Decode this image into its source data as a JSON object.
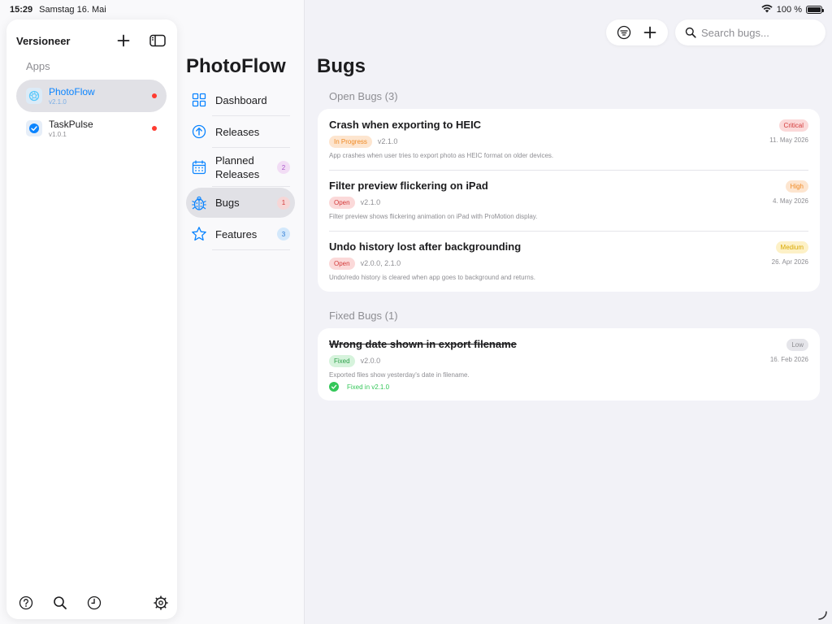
{
  "status_bar": {
    "time": "15:29",
    "date": "Samstag 16. Mai",
    "battery": "100 %"
  },
  "sidebar": {
    "title": "Versioneer",
    "section_label": "Apps",
    "apps": [
      {
        "name": "PhotoFlow",
        "version": "v2.1.0",
        "selected": true,
        "icon": "camera-aperture-icon",
        "color": "#5ac8fa"
      },
      {
        "name": "TaskPulse",
        "version": "v1.0.1",
        "selected": false,
        "icon": "checkmark-circle-icon",
        "color": "#0a84ff"
      }
    ]
  },
  "nav": {
    "project_title": "PhotoFlow",
    "items": [
      {
        "label": "Dashboard",
        "icon": "grid-icon",
        "badge": ""
      },
      {
        "label": "Releases",
        "icon": "arrow-up-circle-icon",
        "badge": ""
      },
      {
        "label": "Planned\nReleases",
        "icon": "calendar-icon",
        "badge": "2",
        "badge_color": "#f2ddf5",
        "badge_text_color": "#a855c8"
      },
      {
        "label": "Bugs",
        "icon": "ladybug-icon",
        "badge": "1",
        "badge_color": "#f6d6d6",
        "badge_text_color": "#d33b3b",
        "selected": true
      },
      {
        "label": "Features",
        "icon": "star-icon",
        "badge": "3",
        "badge_color": "#d3e8fb",
        "badge_text_color": "#2a7ad5"
      }
    ]
  },
  "main": {
    "page_title": "Bugs",
    "search_placeholder": "Search bugs...",
    "open_section": "Open Bugs (3)",
    "fixed_section": "Fixed Bugs (1)",
    "open_bugs": [
      {
        "title": "Crash when exporting to HEIC",
        "severity": "Critical",
        "status": "In Progress",
        "versions": "v2.1.0",
        "date": "11. May 2026",
        "description": "App crashes when user tries to export photo as HEIC format on older devices."
      },
      {
        "title": "Filter preview flickering on iPad",
        "severity": "High",
        "status": "Open",
        "versions": "v2.1.0",
        "date": "4. May 2026",
        "description": "Filter preview shows flickering animation on iPad with ProMotion display."
      },
      {
        "title": "Undo history lost after backgrounding",
        "severity": "Medium",
        "status": "Open",
        "versions": "v2.0.0, 2.1.0",
        "date": "26. Apr 2026",
        "description": "Undo/redo history is cleared when app goes to background and returns."
      }
    ],
    "fixed_bugs": [
      {
        "title": "Wrong date shown in export filename",
        "severity": "Low",
        "status": "Fixed",
        "versions": "v2.0.0",
        "date": "16. Feb 2026",
        "description": "Exported files show yesterday's date in filename.",
        "fixed_in": "Fixed in v2.1.0"
      }
    ]
  },
  "colors": {
    "accent": "#0a84ff",
    "critical_bg": "#fbd9d9",
    "critical_fg": "#d33b3b",
    "high_bg": "#fde5cf",
    "high_fg": "#f08a24",
    "medium_bg": "#fdf1c7",
    "medium_fg": "#d9a800",
    "low_bg": "#e5e5ea",
    "low_fg": "#8e8e93",
    "inprogress_bg": "#fde5cf",
    "inprogress_fg": "#f08a24",
    "open_bg": "#fbd9d9",
    "open_fg": "#d33b3b",
    "fixed_bg": "#d6f3dc",
    "fixed_fg": "#2ea04a"
  }
}
